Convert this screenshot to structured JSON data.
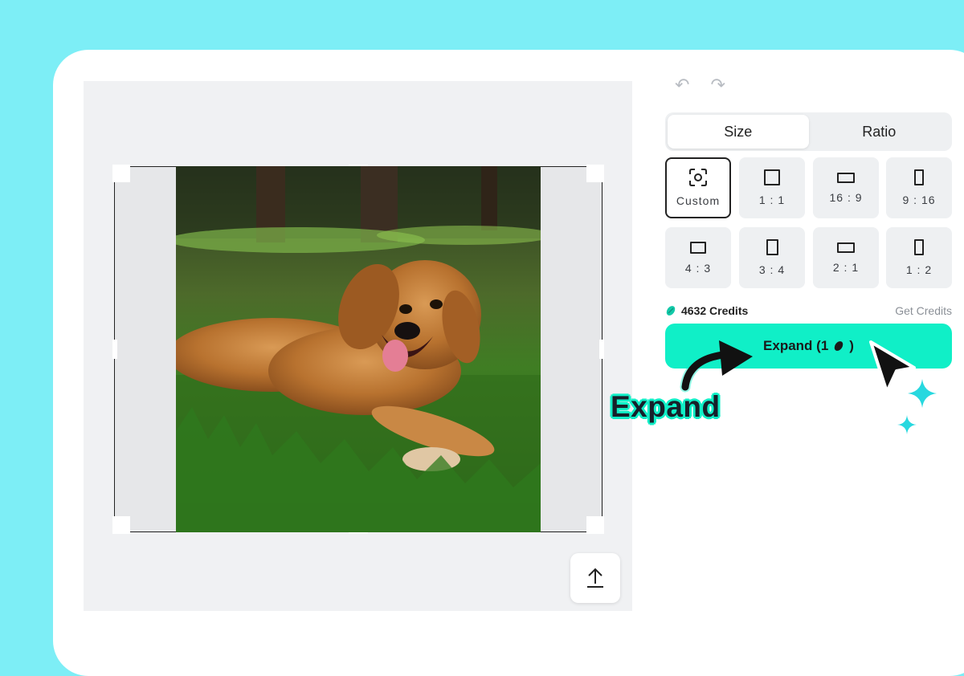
{
  "tabs": [
    {
      "label": "Size",
      "active": true
    },
    {
      "label": "Ratio",
      "active": false
    }
  ],
  "ratios": [
    {
      "label": "Custom",
      "icon": "custom-focus-icon",
      "selected": true
    },
    {
      "label": "1 : 1",
      "icon": "square-icon"
    },
    {
      "label": "16 : 9",
      "icon": "landscape-wide-icon"
    },
    {
      "label": "9 : 16",
      "icon": "portrait-tall-icon"
    },
    {
      "label": "4 : 3",
      "icon": "landscape-icon"
    },
    {
      "label": "3 : 4",
      "icon": "portrait-icon"
    },
    {
      "label": "2 : 1",
      "icon": "landscape-wide-icon"
    },
    {
      "label": "1 : 2",
      "icon": "portrait-tall-icon"
    }
  ],
  "credits": {
    "amount_label": "4632 Credits",
    "get_label": "Get Credits"
  },
  "expand_button": {
    "label": "Expand (1",
    "suffix": ")"
  },
  "callout": {
    "text": "Expand"
  },
  "colors": {
    "accent": "#10efc7",
    "background": "#7deef6",
    "canvas": "#f0f1f3"
  }
}
